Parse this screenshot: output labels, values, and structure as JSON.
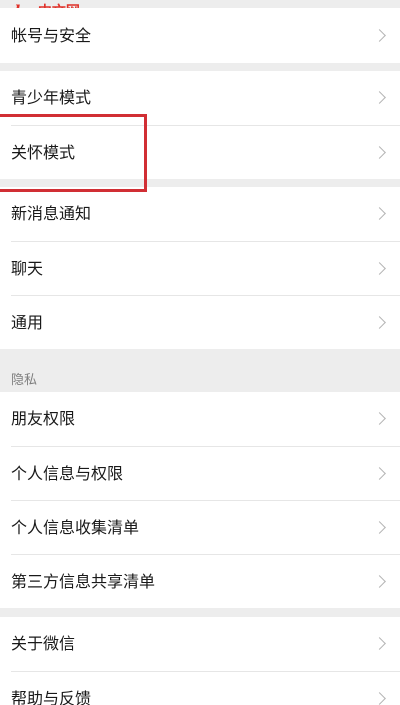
{
  "watermark": {
    "php": "php",
    "cn": "中文网"
  },
  "groups": {
    "account": [
      {
        "label": "帐号与安全"
      }
    ],
    "modes": [
      {
        "label": "青少年模式"
      },
      {
        "label": "关怀模式"
      }
    ],
    "general": [
      {
        "label": "新消息通知"
      },
      {
        "label": "聊天"
      },
      {
        "label": "通用"
      }
    ],
    "privacy_header": "隐私",
    "privacy": [
      {
        "label": "朋友权限"
      },
      {
        "label": "个人信息与权限"
      },
      {
        "label": "个人信息收集清单"
      },
      {
        "label": "第三方信息共享清单"
      }
    ],
    "about": [
      {
        "label": "关于微信"
      },
      {
        "label": "帮助与反馈"
      }
    ]
  },
  "colors": {
    "highlight": "#d12e34",
    "background": "#ededed"
  }
}
